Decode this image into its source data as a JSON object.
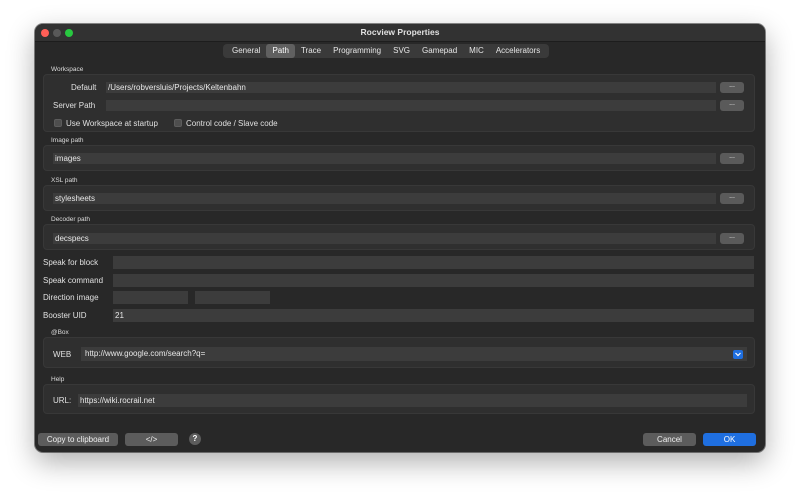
{
  "window": {
    "title": "Rocview Properties"
  },
  "tabs": [
    {
      "label": "General"
    },
    {
      "label": "Path",
      "active": true
    },
    {
      "label": "Trace"
    },
    {
      "label": "Programming"
    },
    {
      "label": "SVG"
    },
    {
      "label": "Gamepad"
    },
    {
      "label": "MIC"
    },
    {
      "label": "Accelerators"
    }
  ],
  "workspace": {
    "section_label": "Workspace",
    "default_label": "Default",
    "default_value": "/Users/robversluis/Projects/Keltenbahn",
    "server_path_label": "Server Path",
    "server_path_value": "",
    "browse_label": "...",
    "use_workspace_label": "Use Workspace at startup",
    "control_code_label": "Control code / Slave code"
  },
  "image_path": {
    "section_label": "Image path",
    "value": "images",
    "browse_label": "..."
  },
  "xsl_path": {
    "section_label": "XSL path",
    "value": "stylesheets",
    "browse_label": "..."
  },
  "decoder_path": {
    "section_label": "Decoder path",
    "value": "decspecs",
    "browse_label": "..."
  },
  "speak_block": {
    "label": "Speak for block",
    "value": ""
  },
  "speak_command": {
    "label": "Speak command",
    "value": ""
  },
  "direction_image": {
    "label": "Direction image",
    "value1": "",
    "value2": ""
  },
  "booster_uid": {
    "label": "Booster UID",
    "value": "21"
  },
  "box": {
    "section_label": "@Box",
    "web_label": "WEB",
    "web_value": "http://www.google.com/search?q="
  },
  "help": {
    "section_label": "Help",
    "url_label": "URL:",
    "url_value": "https://wiki.rocrail.net"
  },
  "footer": {
    "copy_label": "Copy to clipboard",
    "code_label": "</>",
    "help_label": "?",
    "cancel_label": "Cancel",
    "ok_label": "OK"
  },
  "colors": {
    "accent": "#1f6fe0",
    "background": "#282828",
    "field": "#3c3c3c",
    "close": "#ff5f57",
    "maximize": "#28c840"
  }
}
